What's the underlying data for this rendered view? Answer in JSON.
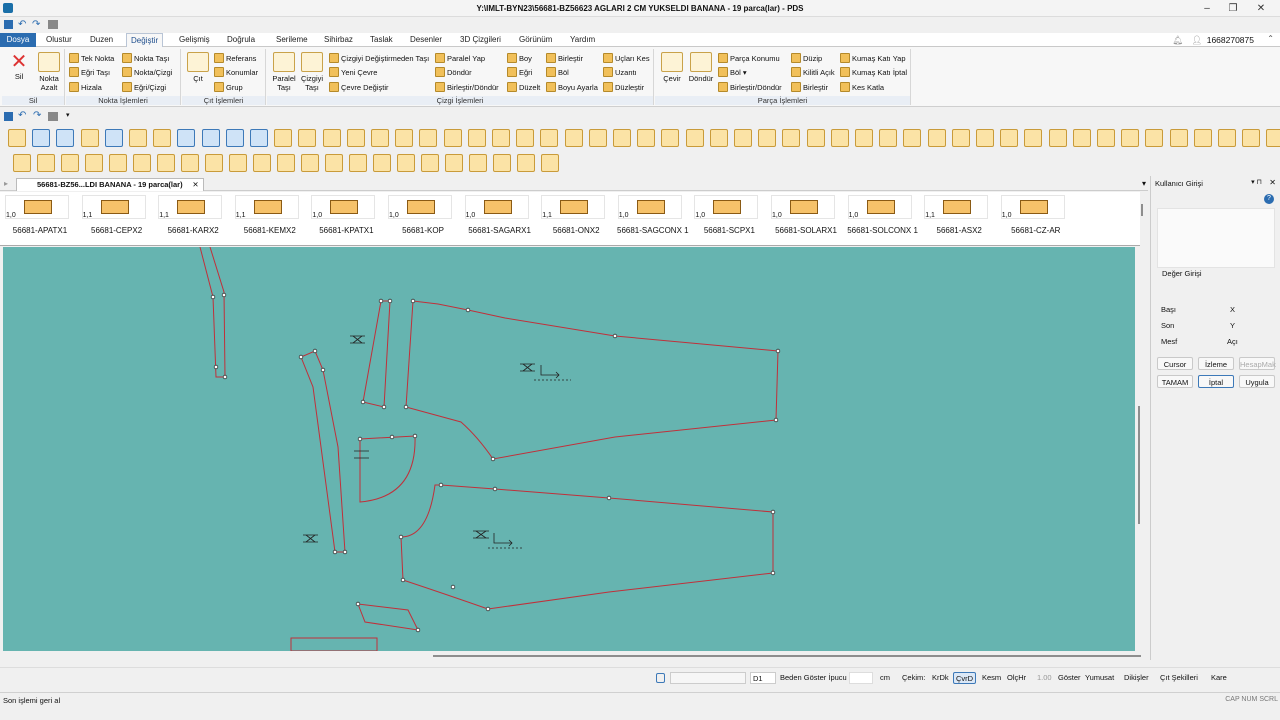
{
  "window": {
    "title": "Y:\\IMLT-BYN23\\56681-BZ56623 AGLARI 2 CM YUKSELDI BANANA  -  19 parca(lar) - PDS",
    "min": "–",
    "max": "❐",
    "close": "✕"
  },
  "menu_tabs": [
    "Dosya",
    "Olustur",
    "Duzen",
    "Değiştir",
    "Gelişmiş",
    "Doğrula",
    "Serileme",
    "Sihirbaz",
    "Taslak",
    "Desenler",
    "3D Çizgileri",
    "Görünüm",
    "Yardım"
  ],
  "user": {
    "id": "1668270875"
  },
  "ribbon": {
    "groups": [
      "Sil",
      "Nokta İşlemleri",
      "Çıt İşlemleri",
      "Çizgi İşlemleri",
      "Parça İşlemleri"
    ],
    "sil": {
      "sil": "Sil",
      "nokta_azalt": "Nokta Azalt"
    },
    "nokta": [
      "Tek Nokta",
      "Eğri Taşı",
      "Hizala",
      "Nokta Taşı",
      "Nokta/Çizgi",
      "Eğri/Çizgi"
    ],
    "cit": {
      "cit": "Çıt",
      "items": [
        "Referans",
        "Konumlar",
        "Grup"
      ]
    },
    "cizgi": {
      "paralel_tasi": "Paralel Taşı",
      "cizgiyi_tasi": "Çizgiyi Taşı",
      "items": [
        "Çizgiyi Değiştirmeden Taşı",
        "Yeni Çevre",
        "Çevre Değiştir",
        "Paralel Yap",
        "Döndür",
        "Birleştir/Döndür",
        "Boy",
        "Eğri",
        "Düzelt",
        "Birleştir",
        "Böl",
        "Boyu Ayarla",
        "Uçları Kes",
        "Uzantı",
        "Düzleştir"
      ]
    },
    "parca": {
      "cevir": "Çevir",
      "dondur": "Döndür",
      "items": [
        "Parça Konumu",
        "Böl ▾",
        "Birleştir/Döndür",
        "Düzip",
        "Kilitli Açık",
        "Birleştir",
        "Kumaş Katı Yap",
        "Kumaş Katı İptal",
        "Kes Katla"
      ]
    }
  },
  "doc_tab": {
    "label": "56681-BZ56...LDI BANANA  -  19 parca(lar)",
    "close": "✕"
  },
  "pieces": [
    {
      "name": "56681-APATX1",
      "scale": "1,0"
    },
    {
      "name": "56681-CEPX2",
      "scale": "1,1"
    },
    {
      "name": "56681-KARX2",
      "scale": "1,1"
    },
    {
      "name": "56681-KEMX2",
      "scale": "1,1"
    },
    {
      "name": "56681-KPATX1",
      "scale": "1,0"
    },
    {
      "name": "56681-KOP",
      "scale": "1,0"
    },
    {
      "name": "56681-SAGARX1",
      "scale": "1,0"
    },
    {
      "name": "56681-ONX2",
      "scale": "1,1"
    },
    {
      "name": "56681-SAGCONX 1",
      "scale": "1,0"
    },
    {
      "name": "56681-SCPX1",
      "scale": "1,0"
    },
    {
      "name": "56681-SOLARX1",
      "scale": "1,0"
    },
    {
      "name": "56681-SOLCONX 1",
      "scale": "1,0"
    },
    {
      "name": "56681-ASX2",
      "scale": "1,1"
    },
    {
      "name": "56681-CZ-AR",
      "scale": "1,0"
    }
  ],
  "panel": {
    "title": "Kullanıcı Girişi",
    "deger": "Değer Girişi",
    "labels": [
      "Başı",
      "Son",
      "Mesf"
    ],
    "xyz": [
      "X",
      "Y",
      "Açı"
    ],
    "buttons": [
      "Cursor",
      "İzleme",
      "HesapMak",
      "TAMAM",
      "İptal",
      "Uygula"
    ]
  },
  "status": {
    "field": "D1",
    "items": [
      "Beden Göster İpucu",
      "cm",
      "Çekim:",
      "KrDk",
      "ÇvrD",
      "Kesm",
      "OlçHr",
      "1.00",
      "Göster",
      "Yumusat",
      "Dikişler",
      "Çıt Şekilleri",
      "Kare"
    ]
  },
  "bottom": {
    "message": "Son işlemi geri al",
    "caps": "CAP  NUM  SCRL"
  }
}
